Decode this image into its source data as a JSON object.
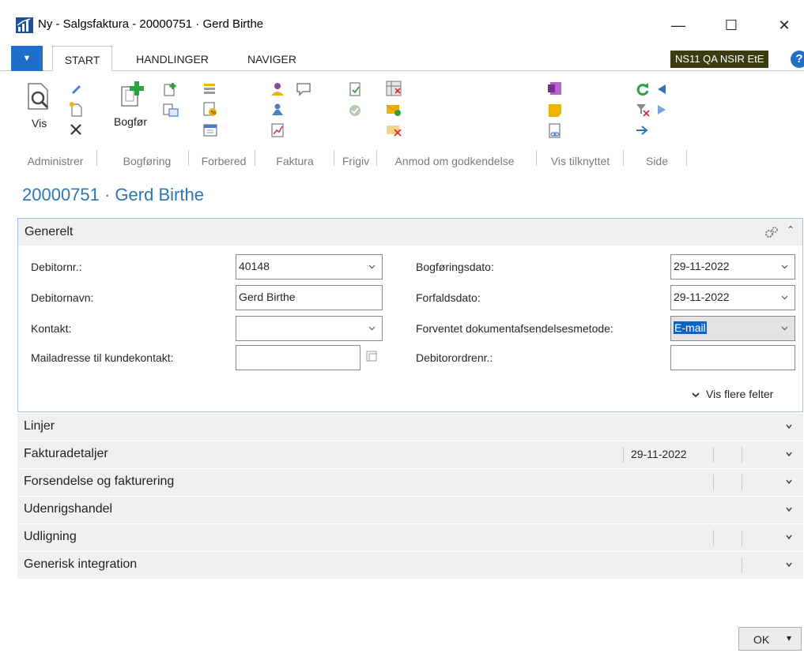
{
  "window": {
    "title": "Ny - Salgsfaktura - 20000751 · Gerd Birthe",
    "minimize_glyph": "—",
    "maximize_glyph": "☐",
    "close_glyph": "✕"
  },
  "ribbon_tabs": {
    "file_menu_glyph": "▼",
    "tabs": [
      {
        "label": "START",
        "active": true
      },
      {
        "label": "HANDLINGER",
        "active": false
      },
      {
        "label": "NAVIGER",
        "active": false
      }
    ],
    "company_badge": "NS11 QA NSIR EtE",
    "help_glyph": "?"
  },
  "ribbon_groups": [
    {
      "label": "Administrer",
      "big_button": "Vis"
    },
    {
      "label": "Bogføring",
      "big_button": "Bogfør"
    },
    {
      "label": "Forbered"
    },
    {
      "label": "Faktura"
    },
    {
      "label": "Frigiv"
    },
    {
      "label": "Anmod om godkendelse"
    },
    {
      "label": "Vis tilknyttet"
    },
    {
      "label": "Side"
    }
  ],
  "page": {
    "title": "20000751 · Gerd Birthe"
  },
  "general": {
    "title": "Generelt",
    "fields_left": [
      {
        "label": "Debitornr.:",
        "value": "40148"
      },
      {
        "label": "Debitornavn:",
        "value": "Gerd Birthe"
      },
      {
        "label": "Kontakt:",
        "value": ""
      },
      {
        "label": "Mailadresse til kundekontakt:",
        "value": ""
      }
    ],
    "fields_right": [
      {
        "label": "Bogføringsdato:",
        "value": "29-11-2022"
      },
      {
        "label": "Forfaldsdato:",
        "value": "29-11-2022"
      },
      {
        "label": "Forventet dokumentafsendelsesmetode:",
        "value": "E-mail"
      },
      {
        "label": "Debitorordrenr.:",
        "value": ""
      }
    ],
    "more_fields": "Vis flere felter"
  },
  "sections": [
    {
      "title": "Linjer",
      "value": ""
    },
    {
      "title": "Fakturadetaljer",
      "value": "29-11-2022"
    },
    {
      "title": "Forsendelse og fakturering",
      "value": ""
    },
    {
      "title": "Udenrigshandel",
      "value": ""
    },
    {
      "title": "Udligning",
      "value": ""
    },
    {
      "title": "Generisk integration",
      "value": ""
    }
  ],
  "footer": {
    "ok_label": "OK",
    "ok_arrow": "▾"
  },
  "colors": {
    "accent_blue": "#2e75b6",
    "company_badge_bg": "#3a3d11",
    "section_bg": "#f0f0f0",
    "panel_border": "#9fc3e8"
  }
}
